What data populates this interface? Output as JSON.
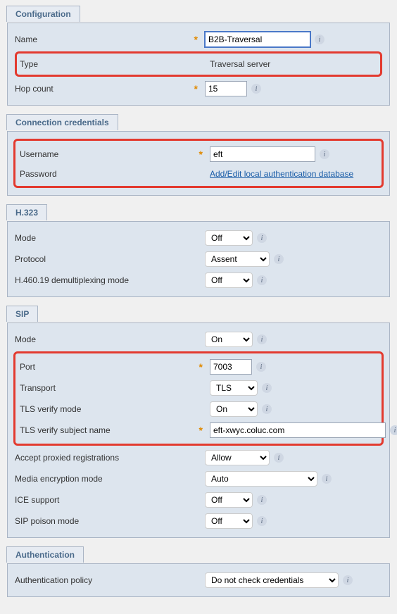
{
  "configuration": {
    "title": "Configuration",
    "name_label": "Name",
    "name_value": "B2B-Traversal",
    "type_label": "Type",
    "type_value": "Traversal server",
    "hopcount_label": "Hop count",
    "hopcount_value": "15"
  },
  "credentials": {
    "title": "Connection credentials",
    "username_label": "Username",
    "username_value": "eft",
    "password_label": "Password",
    "password_link": "Add/Edit local authentication database"
  },
  "h323": {
    "title": "H.323",
    "mode_label": "Mode",
    "mode_value": "Off",
    "protocol_label": "Protocol",
    "protocol_value": "Assent",
    "demux_label": "H.460.19 demultiplexing mode",
    "demux_value": "Off"
  },
  "sip": {
    "title": "SIP",
    "mode_label": "Mode",
    "mode_value": "On",
    "port_label": "Port",
    "port_value": "7003",
    "transport_label": "Transport",
    "transport_value": "TLS",
    "verify_mode_label": "TLS verify mode",
    "verify_mode_value": "On",
    "verify_subject_label": "TLS verify subject name",
    "verify_subject_value": "eft-xwyc.coluc.com",
    "accept_proxied_label": "Accept proxied registrations",
    "accept_proxied_value": "Allow",
    "media_enc_label": "Media encryption mode",
    "media_enc_value": "Auto",
    "ice_label": "ICE support",
    "ice_value": "Off",
    "poison_label": "SIP poison mode",
    "poison_value": "Off"
  },
  "auth": {
    "title": "Authentication",
    "policy_label": "Authentication policy",
    "policy_value": "Do not check credentials"
  }
}
